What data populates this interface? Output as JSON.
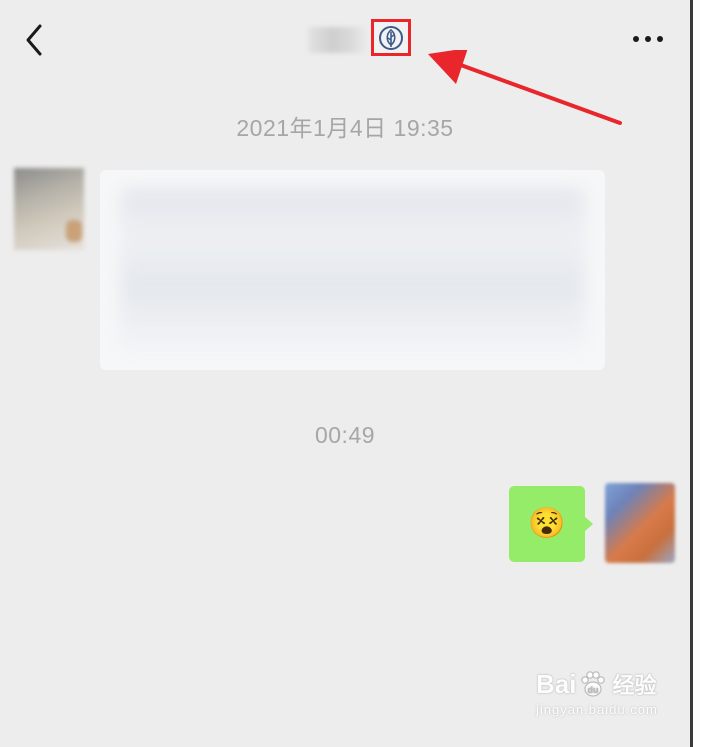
{
  "header": {
    "back_icon": "chevron-left-icon",
    "verified_icon": "leaf-badge-icon",
    "more_icon": "more-dots-icon"
  },
  "messages": {
    "timestamp_1": "2021年1月4日 19:35",
    "timestamp_2": "00:49",
    "sticker_emoji": "😵"
  },
  "annotation": {
    "highlight_color": "#e8262c",
    "arrow_color": "#e8262c"
  },
  "watermark": {
    "brand": "Bai",
    "brand_suffix": "经验",
    "url": "jingyan.baidu.com"
  },
  "colors": {
    "background": "#ededed",
    "sent_bubble": "#95ec69",
    "received_bubble": "#f6f7f8",
    "timestamp_text": "#a6a6a6"
  }
}
